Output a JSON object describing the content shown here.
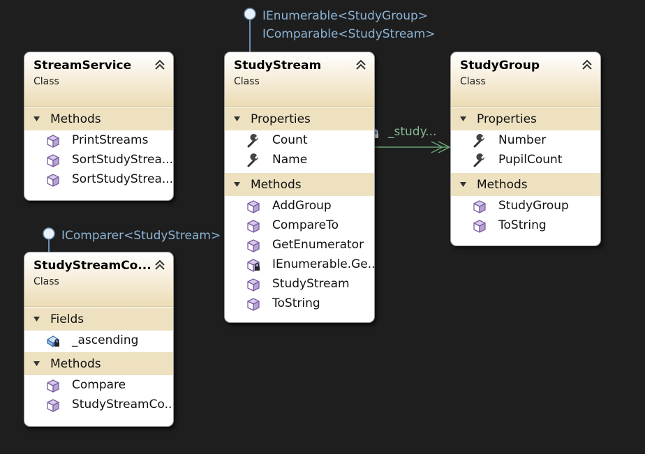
{
  "colors": {
    "background": "#1e1e1e",
    "interface_line": "#6d8fb0",
    "interface_text": "#8cb4d6",
    "association": "#6aa374",
    "header_gradient_end": "#ecdcb5",
    "section_bg": "#ede1c0",
    "member_icon": "#8c6fb4"
  },
  "interfaces": {
    "study_stream_1": "IEnumerable<StudyGroup>",
    "study_stream_2": "IComparable<StudyStream>",
    "comparer": "IComparer<StudyStream>"
  },
  "association": {
    "label": "_study..."
  },
  "classes": {
    "stream_service": {
      "name": "StreamService",
      "kind": "Class",
      "sections": {
        "methods": {
          "title": "Methods",
          "items": [
            "PrintStreams",
            "SortStudyStrea...",
            "SortStudyStrea..."
          ]
        }
      }
    },
    "study_stream": {
      "name": "StudyStream",
      "kind": "Class",
      "sections": {
        "properties": {
          "title": "Properties",
          "items": [
            "Count",
            "Name"
          ]
        },
        "methods": {
          "title": "Methods",
          "items": [
            "AddGroup",
            "CompareTo",
            "GetEnumerator",
            "IEnumerable.Ge...",
            "StudyStream",
            "ToString"
          ]
        }
      }
    },
    "study_group": {
      "name": "StudyGroup",
      "kind": "Class",
      "sections": {
        "properties": {
          "title": "Properties",
          "items": [
            "Number",
            "PupilCount"
          ]
        },
        "methods": {
          "title": "Methods",
          "items": [
            "StudyGroup",
            "ToString"
          ]
        }
      }
    },
    "study_stream_comparer": {
      "name": "StudyStreamCo...",
      "kind": "Class",
      "sections": {
        "fields": {
          "title": "Fields",
          "items": [
            "_ascending"
          ]
        },
        "methods": {
          "title": "Methods",
          "items": [
            "Compare",
            "StudyStreamCo..."
          ]
        }
      }
    }
  }
}
